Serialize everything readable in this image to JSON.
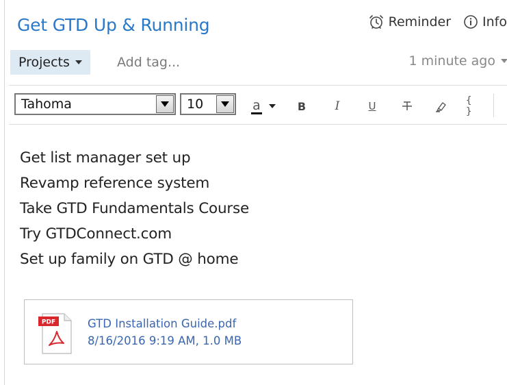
{
  "note": {
    "title": "Get GTD Up & Running",
    "lines": [
      "Get list manager set up",
      "Revamp reference system",
      "Take GTD Fundamentals Course",
      "Try GTDConnect.com",
      "Set up family on GTD @ home"
    ]
  },
  "actions": {
    "reminder_label": "Reminder",
    "info_label": "Info",
    "reminder_icon": "alarm-clock-icon",
    "info_icon": "info-circle-icon"
  },
  "meta": {
    "notebook": "Projects",
    "tag_placeholder": "Add tag...",
    "updated": "1 minute ago"
  },
  "toolbar": {
    "font_family": "Tahoma",
    "font_size": "10",
    "color_letter": "a",
    "bold": "B",
    "italic": "I",
    "underline": "U",
    "strike": "T",
    "code": "{ }"
  },
  "attachment": {
    "badge": "PDF",
    "name": "GTD Installation Guide.pdf",
    "meta": "8/16/2016 9:19 AM, 1.0 MB",
    "icon": "pdf-file-icon"
  },
  "colors": {
    "title_blue": "#2a78c8",
    "notebook_bg": "#dde9f3",
    "link_blue": "#3a66b0",
    "pdf_red": "#d9272e"
  }
}
